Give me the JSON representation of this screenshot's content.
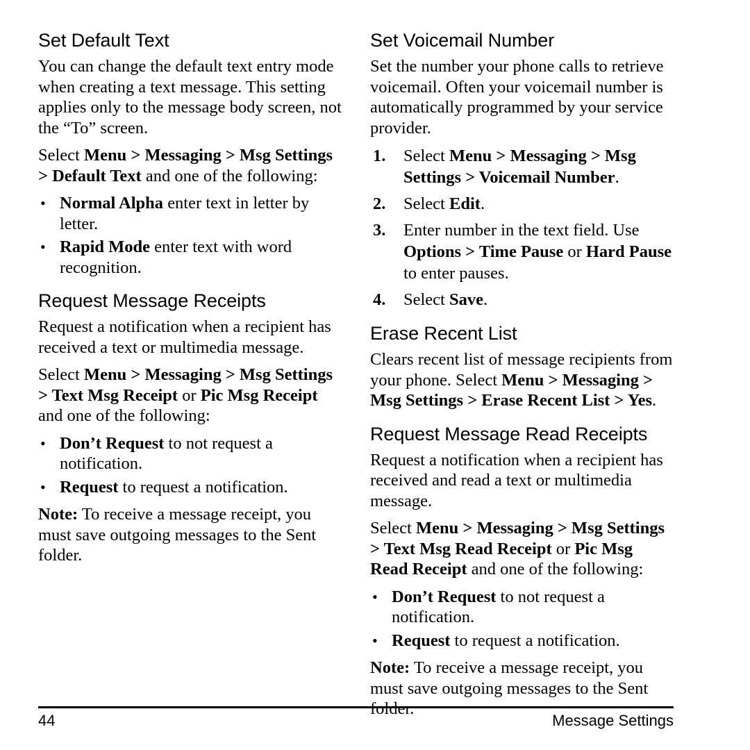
{
  "page": {
    "number": "44",
    "running_head": "Message Settings"
  },
  "left_column": [
    {
      "heading": "Set Default Text",
      "paragraphs": [
        [
          {
            "t": "You can change the default text entry mode when creating a text message. This setting applies only to the message body screen, not the “To” screen.",
            "b": false
          }
        ],
        [
          {
            "t": "Select ",
            "b": false
          },
          {
            "t": "Menu > Messaging > Msg Settings > Default Text",
            "b": true
          },
          {
            "t": " and one of the following:",
            "b": false
          }
        ]
      ],
      "bullets": [
        [
          {
            "t": "Normal Alpha",
            "b": true
          },
          {
            "t": " enter text in letter by letter.",
            "b": false
          }
        ],
        [
          {
            "t": "Rapid Mode",
            "b": true
          },
          {
            "t": " enter text with word recognition.",
            "b": false
          }
        ]
      ]
    },
    {
      "heading": "Request Message Receipts",
      "paragraphs": [
        [
          {
            "t": "Request a notification when a recipient has received a text or multimedia message.",
            "b": false
          }
        ],
        [
          {
            "t": "Select ",
            "b": false
          },
          {
            "t": "Menu > Messaging > Msg Settings > Text Msg Receipt",
            "b": true
          },
          {
            "t": " or ",
            "b": false
          },
          {
            "t": "Pic Msg Receipt",
            "b": true
          },
          {
            "t": " and one of the following:",
            "b": false
          }
        ]
      ],
      "bullets": [
        [
          {
            "t": "Don’t Request",
            "b": true
          },
          {
            "t": " to not request a notification.",
            "b": false
          }
        ],
        [
          {
            "t": "Request",
            "b": true
          },
          {
            "t": " to request a notification.",
            "b": false
          }
        ]
      ],
      "note": [
        {
          "t": "Note:",
          "b": true
        },
        {
          "t": " To receive a message receipt, you must save outgoing messages to the Sent folder.",
          "b": false
        }
      ]
    }
  ],
  "right_column": [
    {
      "heading": "Set Voicemail Number",
      "paragraphs": [
        [
          {
            "t": "Set the number your phone calls to retrieve voicemail. Often your voicemail number is automatically programmed by your service provider.",
            "b": false
          }
        ]
      ],
      "steps": [
        {
          "num": "1.",
          "runs": [
            {
              "t": "Select ",
              "b": false
            },
            {
              "t": "Menu > Messaging > Msg Settings > Voicemail Number",
              "b": true
            },
            {
              "t": ".",
              "b": false
            }
          ]
        },
        {
          "num": "2.",
          "runs": [
            {
              "t": "Select ",
              "b": false
            },
            {
              "t": "Edit",
              "b": true
            },
            {
              "t": ".",
              "b": false
            }
          ]
        },
        {
          "num": "3.",
          "runs": [
            {
              "t": "Enter number in the text field. Use ",
              "b": false
            },
            {
              "t": "Options > Time Pause",
              "b": true
            },
            {
              "t": " or ",
              "b": false
            },
            {
              "t": "Hard Pause",
              "b": true
            },
            {
              "t": " to enter pauses.",
              "b": false
            }
          ]
        },
        {
          "num": "4.",
          "runs": [
            {
              "t": "Select ",
              "b": false
            },
            {
              "t": "Save",
              "b": true
            },
            {
              "t": ".",
              "b": false
            }
          ]
        }
      ]
    },
    {
      "heading": "Erase Recent List",
      "paragraphs": [
        [
          {
            "t": "Clears recent list of message recipients from your phone. Select ",
            "b": false
          },
          {
            "t": "Menu > Messaging > Msg Settings > Erase Recent List > Yes",
            "b": true
          },
          {
            "t": ".",
            "b": false
          }
        ]
      ]
    },
    {
      "heading": "Request Message Read Receipts",
      "paragraphs": [
        [
          {
            "t": "Request a notification when a recipient has received and read a text or multimedia message.",
            "b": false
          }
        ],
        [
          {
            "t": "Select ",
            "b": false
          },
          {
            "t": "Menu > Messaging > Msg Settings > Text Msg Read Receipt",
            "b": true
          },
          {
            "t": " or ",
            "b": false
          },
          {
            "t": "Pic Msg Read Receipt",
            "b": true
          },
          {
            "t": " and one of the following:",
            "b": false
          }
        ]
      ],
      "bullets": [
        [
          {
            "t": "Don’t Request",
            "b": true
          },
          {
            "t": " to not request a notification.",
            "b": false
          }
        ],
        [
          {
            "t": "Request",
            "b": true
          },
          {
            "t": " to request a notification.",
            "b": false
          }
        ]
      ],
      "note": [
        {
          "t": "Note:",
          "b": true
        },
        {
          "t": " To receive a message receipt, you must save outgoing messages to the Sent folder.",
          "b": false
        }
      ]
    }
  ],
  "icons": {
    "bullet": "•"
  }
}
